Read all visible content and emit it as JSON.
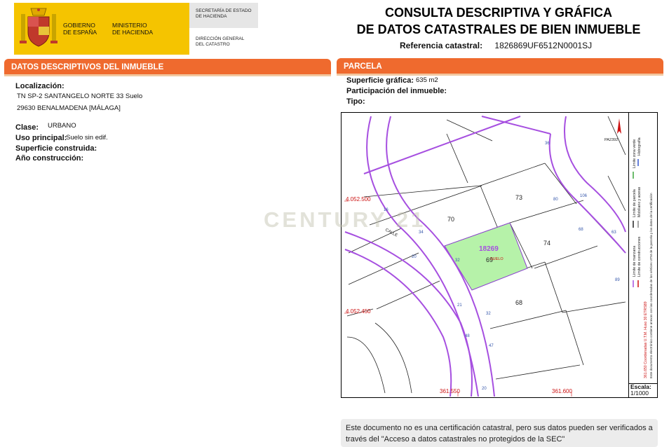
{
  "header": {
    "gov_line1": "GOBIERNO",
    "gov_line2": "DE ESPAÑA",
    "min_line1": "MINISTERIO",
    "min_line2": "DE HACIENDA",
    "sec_line1": "SECRETARÍA DE ESTADO",
    "sec_line2": "DE HACIENDA",
    "dir_line1": "DIRECCIÓN GENERAL",
    "dir_line2": "DEL CATASTRO"
  },
  "title": {
    "line1": "CONSULTA DESCRIPTIVA Y GRÁFICA",
    "line2": "DE DATOS CATASTRALES DE BIEN INMUEBLE",
    "ref_label": "Referencia catastral:",
    "ref_value": "1826869UF6512N0001SJ"
  },
  "descriptivos": {
    "header": "DATOS DESCRIPTIVOS DEL INMUEBLE",
    "localizacion_label": "Localización:",
    "localizacion_line1": "TN SP-2 SANTANGELO NORTE 33 Suelo",
    "localizacion_line2": "29630 BENALMADENA [MÁLAGA]",
    "clase_label": "Clase:",
    "clase_value": "URBANO",
    "uso_label": "Uso principal:",
    "uso_value": "Suelo sin edif.",
    "superficie_label": "Superficie construida:",
    "ano_label": "Año construcción:"
  },
  "parcela": {
    "header": "PARCELA",
    "superficie_label": "Superficie gráfica:",
    "superficie_value": "635 m2",
    "participacion_label": "Participación del inmueble:",
    "tipo_label": "Tipo:"
  },
  "map": {
    "parcel_id": "18269",
    "parcel_sub": "SUELO",
    "plots": [
      "70",
      "73",
      "74",
      "69",
      "68"
    ],
    "y_labels": [
      "4.052.500",
      "4.052.450"
    ],
    "x_labels": [
      "361.550",
      "361.600"
    ],
    "street_label": "CALLE",
    "road_numbers": [
      "16",
      "34",
      "20",
      "32",
      "21",
      "32",
      "48",
      "47",
      "20",
      "36",
      "80",
      "68",
      "106",
      "63",
      "89"
    ],
    "pa_label": "PA2392",
    "legend_items": [
      "Límite de manzana",
      "Límite de parcela",
      "Límite de construcciones",
      "Mobiliario y aceras",
      "Límite zona verde",
      "Hidrografía"
    ],
    "legend_note1": "361.650 Coordenadas U.T.M. Huso 30 ETRS89",
    "legend_note2": "Este documento electrónico contiene anexos con las coordenadas de los vértices UTM de la parcela y los datos de la certificación",
    "escala_label": "Escala:",
    "escala_value": "1/1000",
    "colors": {
      "manzana": "#a64fe0",
      "parcel_fill": "#b6f2a9",
      "red_text": "#cc1111"
    }
  },
  "note": {
    "line1": "Este documento no es una certificación catastral, pero sus datos pueden ser verificados a",
    "line2": "través del \"Acceso a datos catastrales no protegidos de la SEC\""
  },
  "watermark": "CENTURY 21"
}
